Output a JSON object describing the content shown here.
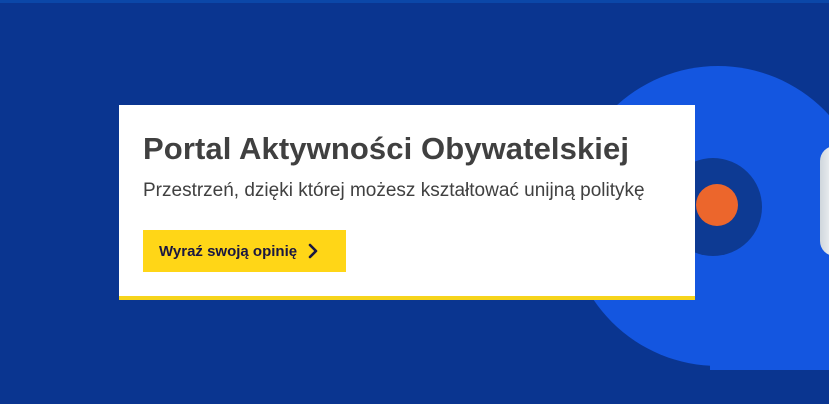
{
  "hero": {
    "title": "Portal Aktywności Obywatelskiej",
    "subtitle": "Przestrzeń, dzięki której możesz kształtować unijną politykę",
    "cta_label": "Wyraź swoją opinię",
    "cta_icon": "chevron-right-icon"
  },
  "colors": {
    "background": "#0a3590",
    "accent_circle": "#1456e0",
    "ring": "#0d3a93",
    "dot": "#ec662c",
    "button": "#ffd617",
    "card_border": "#f6d41c",
    "text": "#404040"
  }
}
